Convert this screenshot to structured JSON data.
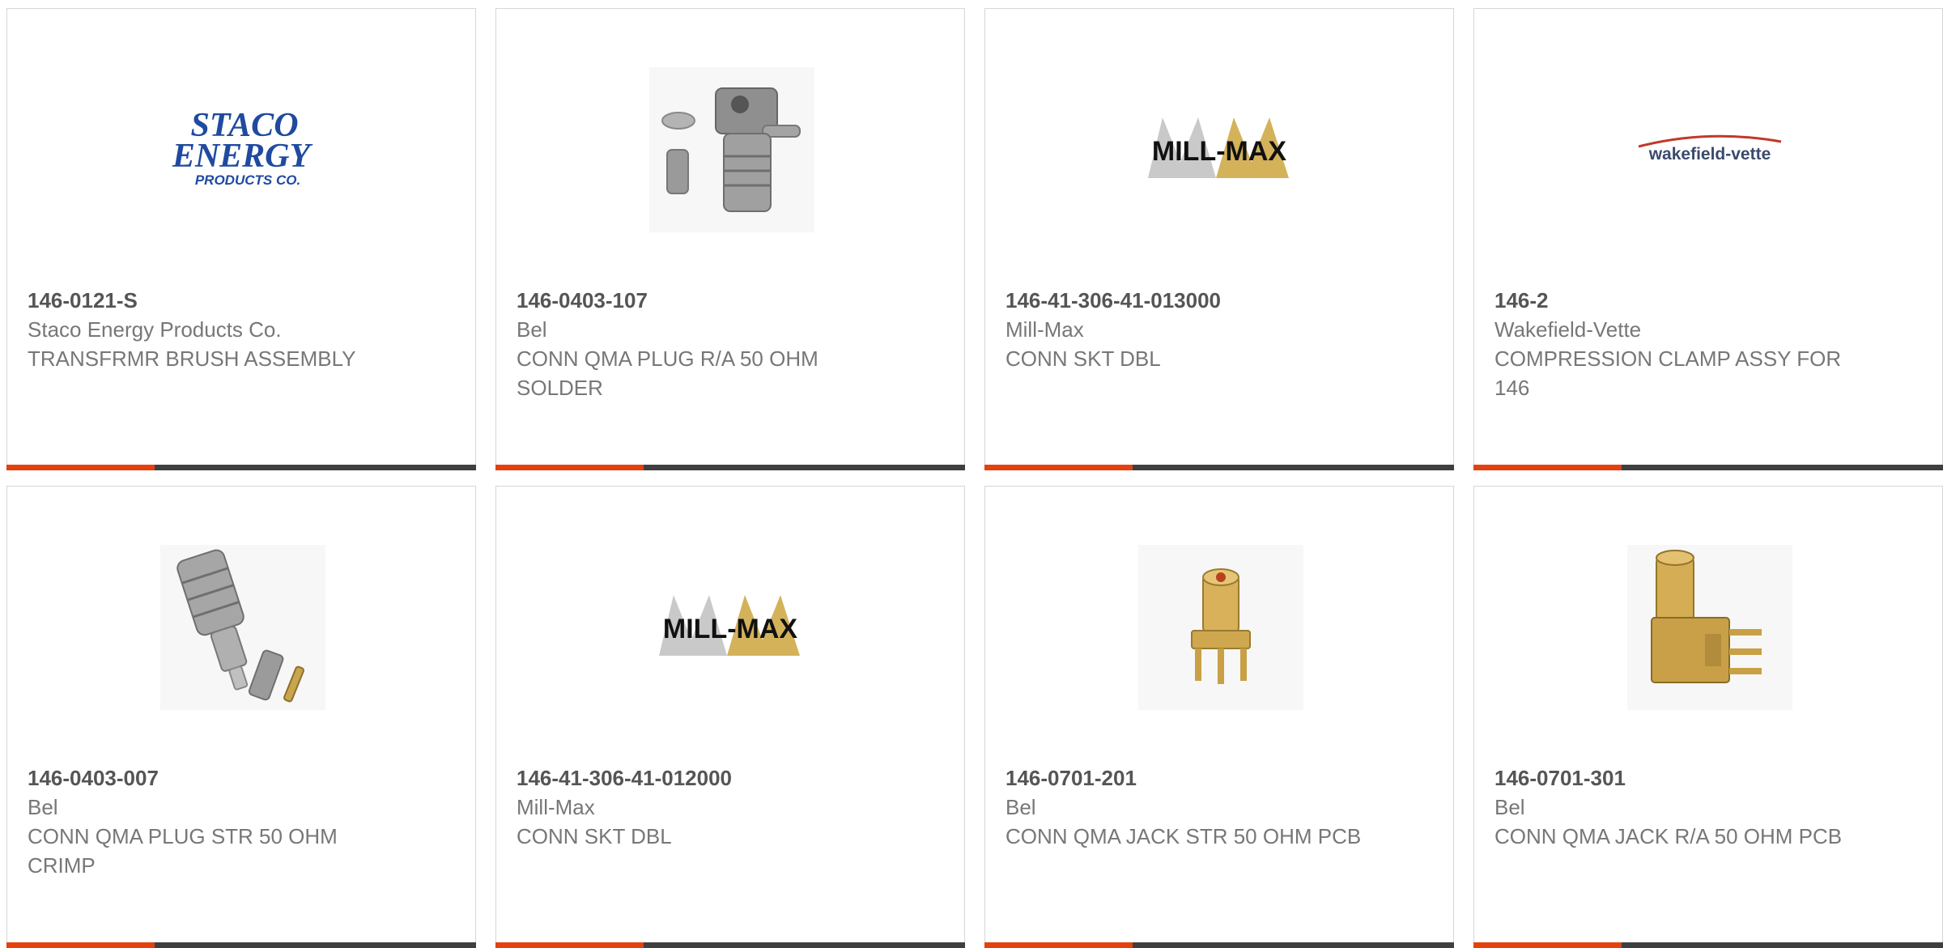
{
  "products": [
    {
      "part_number": "146-0121-S",
      "manufacturer": "Staco Energy Products Co.",
      "description": "TRANSFRMR BRUSH ASSEMBLY",
      "image": "staco-energy-logo",
      "logo_text": [
        "STACO",
        "ENERGY",
        "PRODUCTS CO."
      ]
    },
    {
      "part_number": "146-0403-107",
      "manufacturer": "Bel",
      "description": "CONN QMA PLUG R/A 50 OHM SOLDER",
      "image": "connector-plug-ra-photo"
    },
    {
      "part_number": "146-41-306-41-013000",
      "manufacturer": "Mill-Max",
      "description": "CONN SKT DBL",
      "image": "mill-max-logo",
      "logo_text": "MILL-MAX"
    },
    {
      "part_number": "146-2",
      "manufacturer": "Wakefield-Vette",
      "description": "COMPRESSION CLAMP ASSY FOR 146",
      "image": "wakefield-vette-logo",
      "logo_text": "wakefield-vette"
    },
    {
      "part_number": "146-0403-007",
      "manufacturer": "Bel",
      "description": "CONN QMA PLUG STR 50 OHM CRIMP",
      "image": "connector-plug-str-photo"
    },
    {
      "part_number": "146-41-306-41-012000",
      "manufacturer": "Mill-Max",
      "description": "CONN SKT DBL",
      "image": "mill-max-logo",
      "logo_text": "MILL-MAX"
    },
    {
      "part_number": "146-0701-201",
      "manufacturer": "Bel",
      "description": "CONN QMA JACK STR 50 OHM PCB",
      "image": "connector-jack-str-photo"
    },
    {
      "part_number": "146-0701-301",
      "manufacturer": "Bel",
      "description": "CONN QMA JACK R/A 50 OHM PCB",
      "image": "connector-jack-ra-photo"
    }
  ],
  "colors": {
    "accent": "#e4410f",
    "bar": "#3f3f3f",
    "part_number": "#555555",
    "text": "#777777",
    "border": "#d6d6d6"
  }
}
